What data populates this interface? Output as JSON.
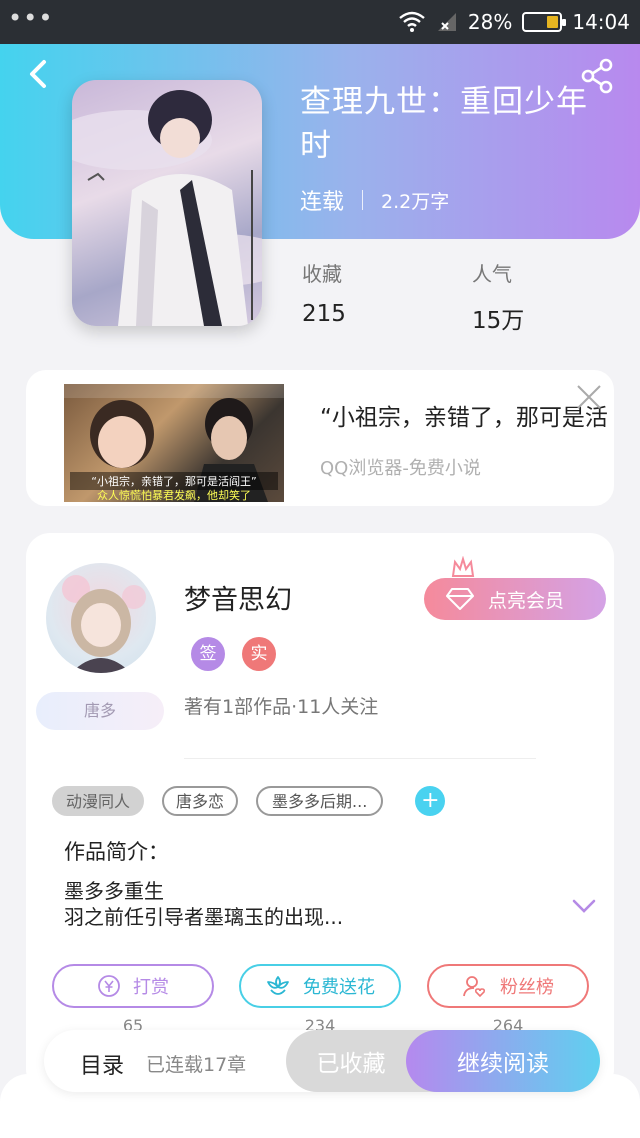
{
  "status_bar": {
    "battery": "28%",
    "time": "14:04"
  },
  "book": {
    "title": "查理九世：重回少年时",
    "status": "连载",
    "word_count": "2.2万字",
    "favorites_label": "收藏",
    "favorites_value": "215",
    "popularity_label": "人气",
    "popularity_value": "15万"
  },
  "ad": {
    "title": "“小祖宗，亲错了，那可是活",
    "source": "QQ浏览器-免费小说",
    "caption": "“小祖宗，亲错了，那可是活阎王”",
    "caption2": "众人惊慌怕暴君发飙，他却笑了"
  },
  "author": {
    "name": "梦音思幻",
    "badge_sign": "签",
    "badge_real": "实",
    "tag": "唐多",
    "stats": "著有1部作品·11人关注",
    "vip_button": "点亮会员"
  },
  "tags": [
    "动漫同人",
    "唐多恋",
    "墨多多后期..."
  ],
  "intro": {
    "label": "作品简介：",
    "line1": "墨多多重生",
    "line2": "羽之前任引导者墨璃玉的出现..."
  },
  "actions": {
    "reward": {
      "label": "打赏",
      "count": "65"
    },
    "flower": {
      "label": "免费送花",
      "count": "234"
    },
    "fans": {
      "label": "粉丝榜",
      "count": "264"
    }
  },
  "bottom": {
    "toc": "目录",
    "chapters": "已连载17章",
    "favorited": "已收藏",
    "continue": "继续阅读"
  },
  "colors": {
    "accent_cyan": "#49d2f0",
    "accent_purple": "#b589ee",
    "reward_purple": "#b58ae6",
    "flower_cyan": "#48cfe6",
    "fans_red": "#ef7878"
  }
}
